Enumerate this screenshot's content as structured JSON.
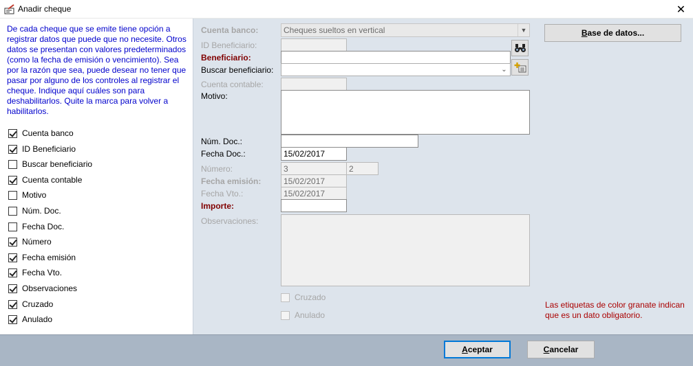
{
  "window": {
    "title": "Anadir cheque",
    "close_symbol": "✕"
  },
  "instructions": "De cada cheque que se emite tiene opción a registrar datos que puede que no necesite. Otros datos se presentan con valores predeterminados (como la fecha de emisión o vencimiento). Sea por la razón que sea, puede desear no tener que pasar por alguno de los controles al registrar el cheque. Indique aquí cuáles son para deshabilitarlos. Quite la marca para volver a habilitarlos.",
  "checklist": [
    {
      "label": "Cuenta banco",
      "checked": true
    },
    {
      "label": "ID Beneficiario",
      "checked": true
    },
    {
      "label": "Buscar beneficiario",
      "checked": false
    },
    {
      "label": "Cuenta contable",
      "checked": true
    },
    {
      "label": "Motivo",
      "checked": false
    },
    {
      "label": "Núm. Doc.",
      "checked": false
    },
    {
      "label": "Fecha Doc.",
      "checked": false
    },
    {
      "label": "Número",
      "checked": true
    },
    {
      "label": "Fecha emisión",
      "checked": true
    },
    {
      "label": "Fecha Vto.",
      "checked": true
    },
    {
      "label": "Observaciones",
      "checked": true
    },
    {
      "label": "Cruzado",
      "checked": true
    },
    {
      "label": "Anulado",
      "checked": true
    }
  ],
  "form": {
    "cuenta_banco": {
      "label": "Cuenta banco:",
      "value": "Cheques sueltos en vertical"
    },
    "id_beneficiario": {
      "label": "ID Beneficiario:",
      "value": ""
    },
    "beneficiario": {
      "label": "Beneficiario:",
      "value": ""
    },
    "buscar_beneficiario": {
      "label": "Buscar beneficiario:",
      "value": ""
    },
    "cuenta_contable": {
      "label": "Cuenta contable:",
      "value": ""
    },
    "motivo": {
      "label": "Motivo:",
      "value": ""
    },
    "num_doc": {
      "label": "Núm. Doc.:",
      "value": ""
    },
    "fecha_doc": {
      "label": "Fecha Doc.:",
      "value": "15/02/2017"
    },
    "numero": {
      "label": "Número:",
      "value": "3",
      "value2": "2"
    },
    "fecha_emision": {
      "label": "Fecha emisión:",
      "value": "15/02/2017"
    },
    "fecha_vto": {
      "label": "Fecha Vto.:",
      "value": "15/02/2017"
    },
    "importe": {
      "label": "Importe:",
      "value": ""
    },
    "observaciones": {
      "label": "Observaciones:",
      "value": ""
    },
    "cruzado": {
      "label": "Cruzado",
      "checked": false
    },
    "anulado": {
      "label": "Anulado",
      "checked": false
    }
  },
  "buttons": {
    "base_datos": {
      "prefix": "B",
      "rest": "ase de datos..."
    },
    "aceptar": {
      "prefix": "A",
      "rest": "ceptar"
    },
    "cancelar": {
      "prefix": "C",
      "rest": "ancelar"
    }
  },
  "note": "Las etiquetas de color granate indican que es un dato obligatorio.",
  "icons": {
    "app": "cheque-app-icon",
    "search": "binoculars-icon",
    "add": "add-record-icon"
  },
  "colors": {
    "instructions_text": "#0000cc",
    "required_label": "#800000",
    "note_text": "#aa0000",
    "panel_bg": "#dde4ec",
    "bottom_bar": "#a9b6c5",
    "default_button_border": "#0078d7"
  }
}
